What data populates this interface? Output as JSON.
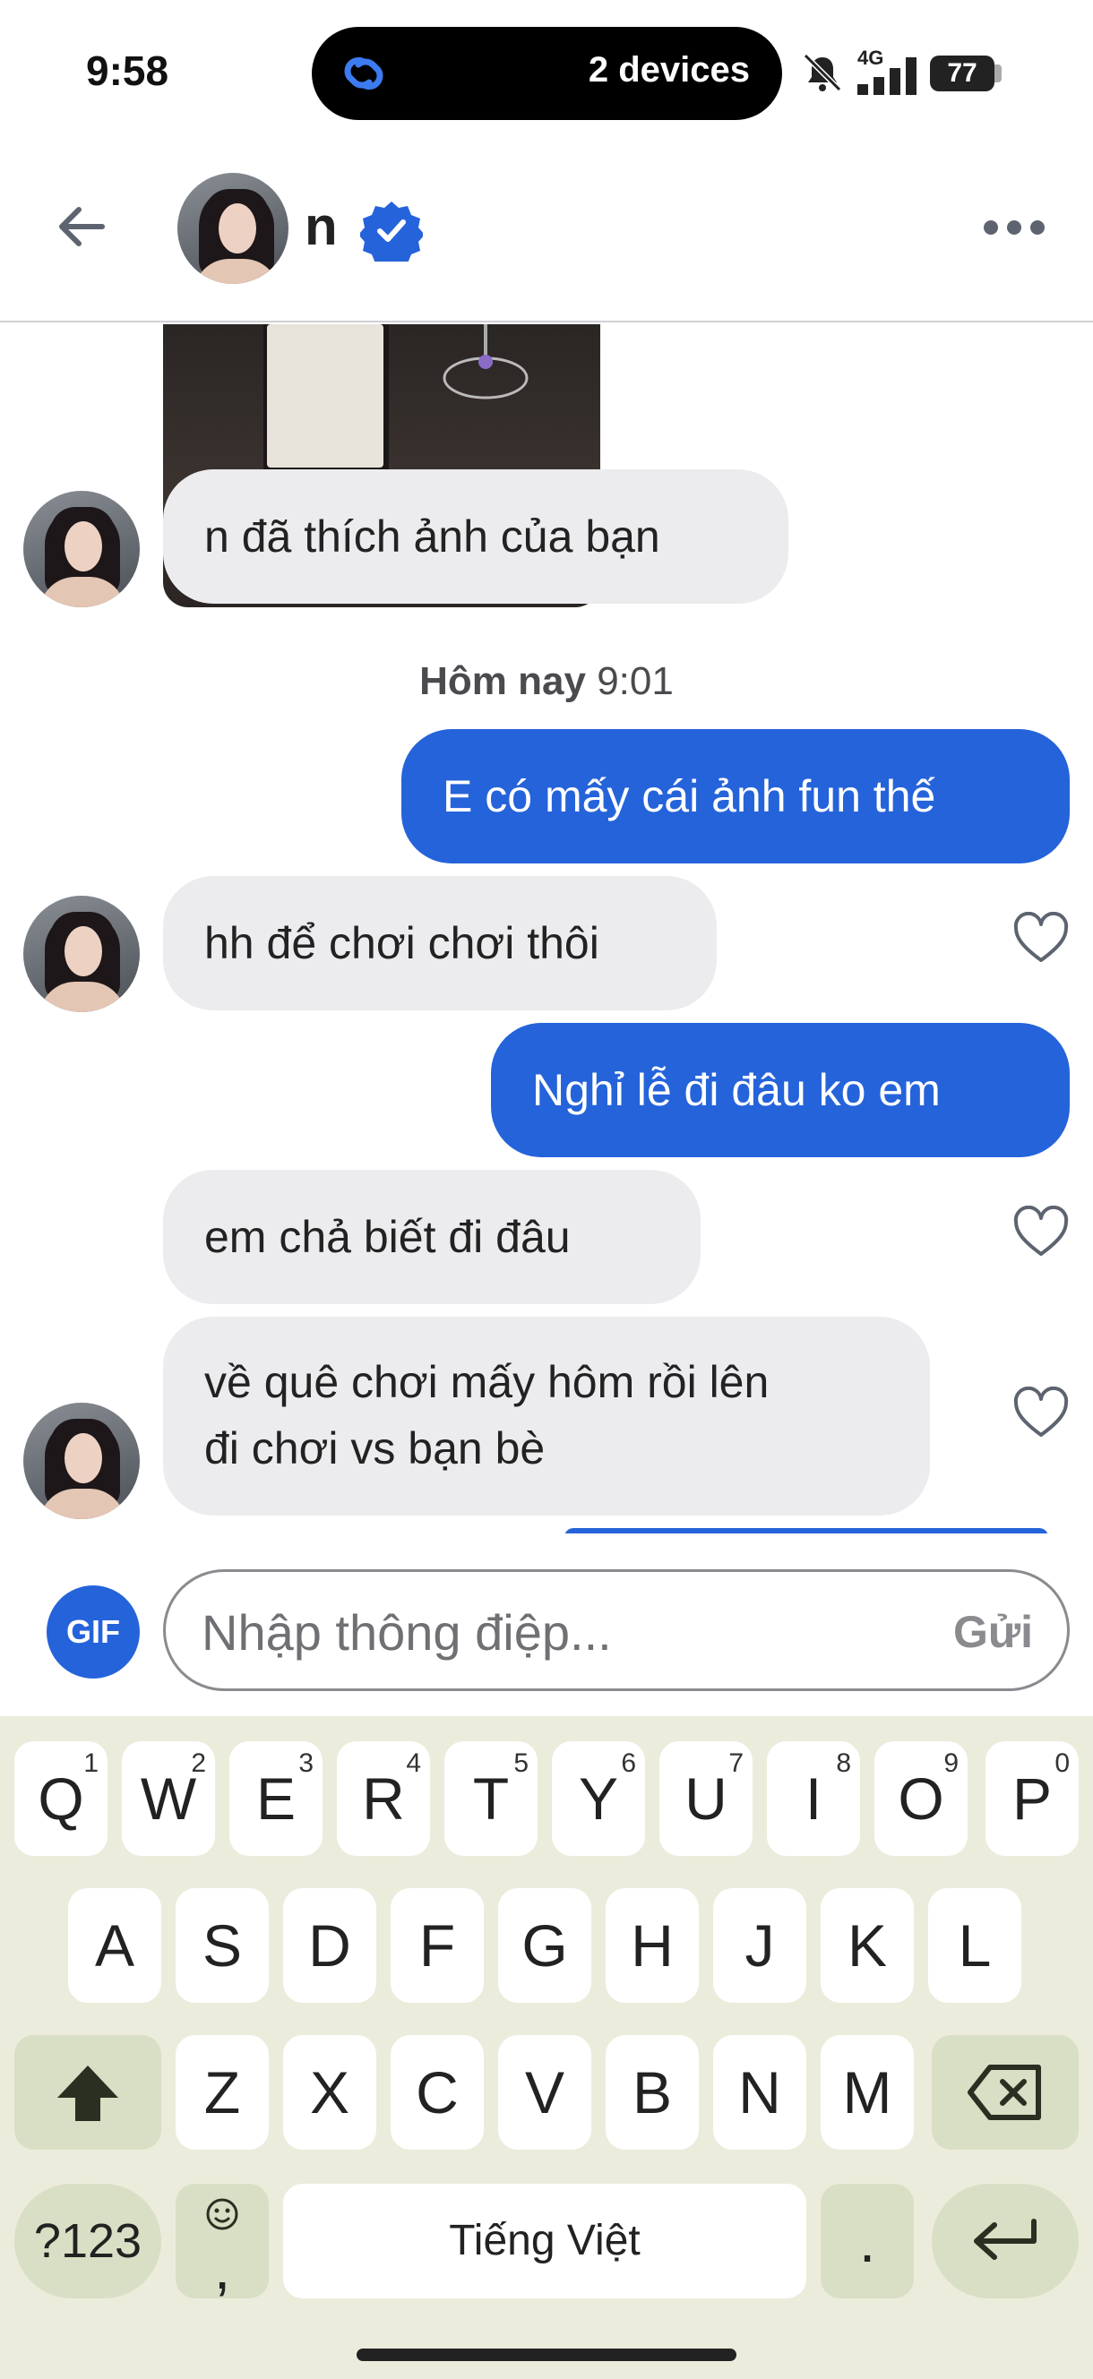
{
  "status_bar": {
    "time": "9:58",
    "island_text": "2 devices",
    "network": "4G",
    "battery": "77"
  },
  "header": {
    "contact_name": "n"
  },
  "messages": [
    {
      "dir": "in",
      "text": "n đã thích ảnh của bạn"
    },
    {
      "dir": "out",
      "text": "E có mấy cái ảnh fun thế"
    },
    {
      "dir": "in",
      "text": "hh để chơi chơi thôi"
    },
    {
      "dir": "out",
      "text": "Nghỉ lễ đi đâu ko em"
    },
    {
      "dir": "in",
      "text": "em chả biết đi đâu"
    },
    {
      "dir": "in",
      "text_line1": "về quê chơi mấy hôm rồi lên",
      "text_line2": "đi chơi vs bạn bè"
    }
  ],
  "timestamp": {
    "day": "Hôm nay",
    "time": "9:01"
  },
  "composer": {
    "gif_label": "GIF",
    "placeholder": "Nhập thông điệp...",
    "send_label": "Gửi"
  },
  "keyboard": {
    "row1": [
      {
        "k": "Q",
        "n": "1"
      },
      {
        "k": "W",
        "n": "2"
      },
      {
        "k": "E",
        "n": "3"
      },
      {
        "k": "R",
        "n": "4"
      },
      {
        "k": "T",
        "n": "5"
      },
      {
        "k": "Y",
        "n": "6"
      },
      {
        "k": "U",
        "n": "7"
      },
      {
        "k": "I",
        "n": "8"
      },
      {
        "k": "O",
        "n": "9"
      },
      {
        "k": "P",
        "n": "0"
      }
    ],
    "row2": [
      "A",
      "S",
      "D",
      "F",
      "G",
      "H",
      "J",
      "K",
      "L"
    ],
    "row3": [
      "Z",
      "X",
      "C",
      "V",
      "B",
      "N",
      "M"
    ],
    "symbols_label": "?123",
    "comma_label": ",",
    "space_label": "Tiếng Việt",
    "period_label": "."
  },
  "colors": {
    "accent": "#2563da",
    "incoming_bubble": "#ececef",
    "keyboard_bg": "#ececdc"
  }
}
